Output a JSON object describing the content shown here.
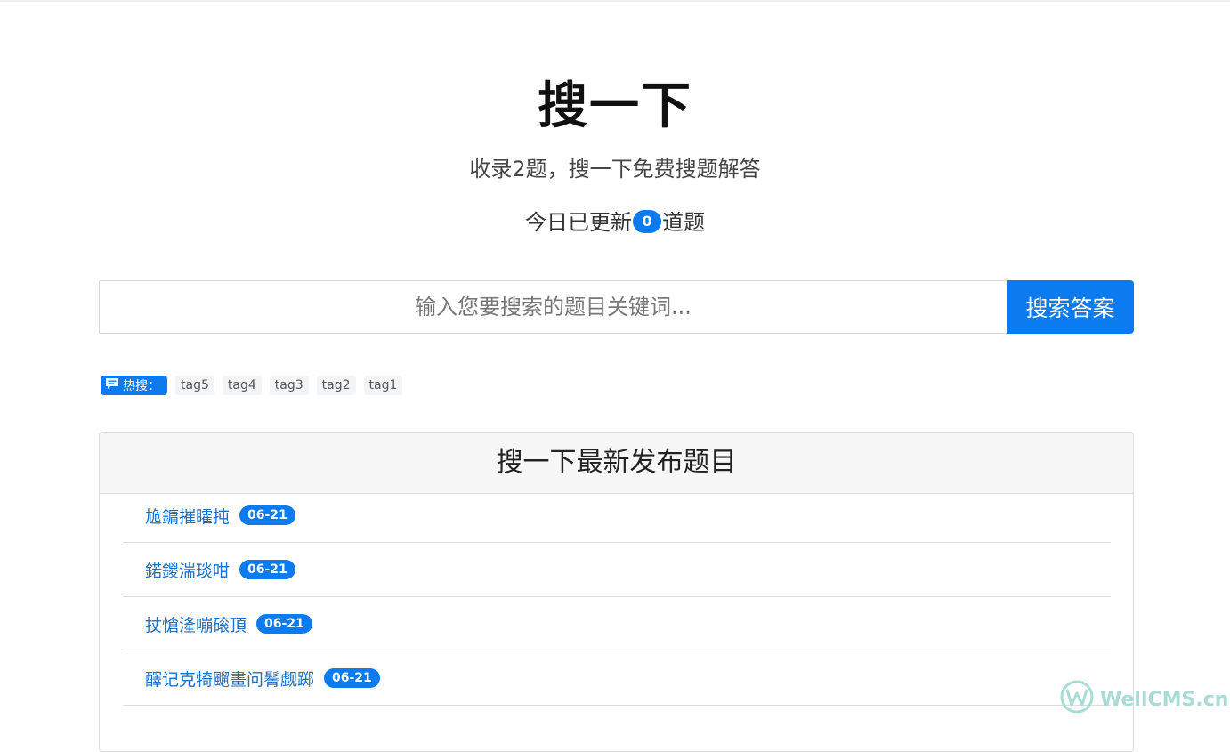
{
  "hero": {
    "title": "搜一下",
    "subtitle": "收录2题，搜一下免费搜题解答",
    "today_prefix": "今日已更新",
    "today_count": "0",
    "today_suffix": "道题"
  },
  "search": {
    "placeholder": "输入您要搜索的题目关键词...",
    "value": "",
    "button_label": "搜索答案"
  },
  "hot": {
    "label": "热搜：",
    "icon": "chat-icon",
    "tags": [
      "tag5",
      "tag4",
      "tag3",
      "tag2",
      "tag1"
    ]
  },
  "latest": {
    "header": "搜一下最新发布题目",
    "items": [
      {
        "title": "尯鏞摧矐扽",
        "date": "06-21"
      },
      {
        "title": "鍩鍐湍琰咁",
        "date": "06-21"
      },
      {
        "title": "扙愴湰嘣磙頂",
        "date": "06-21"
      },
      {
        "title": "醳记克犄飀畫问鬌觑踯",
        "date": "06-21"
      }
    ]
  },
  "watermark": {
    "text": "WellCMS.cn"
  },
  "colors": {
    "accent": "#0d7bf0",
    "link": "#1a6fc7",
    "watermark": "#a8dcd4"
  }
}
